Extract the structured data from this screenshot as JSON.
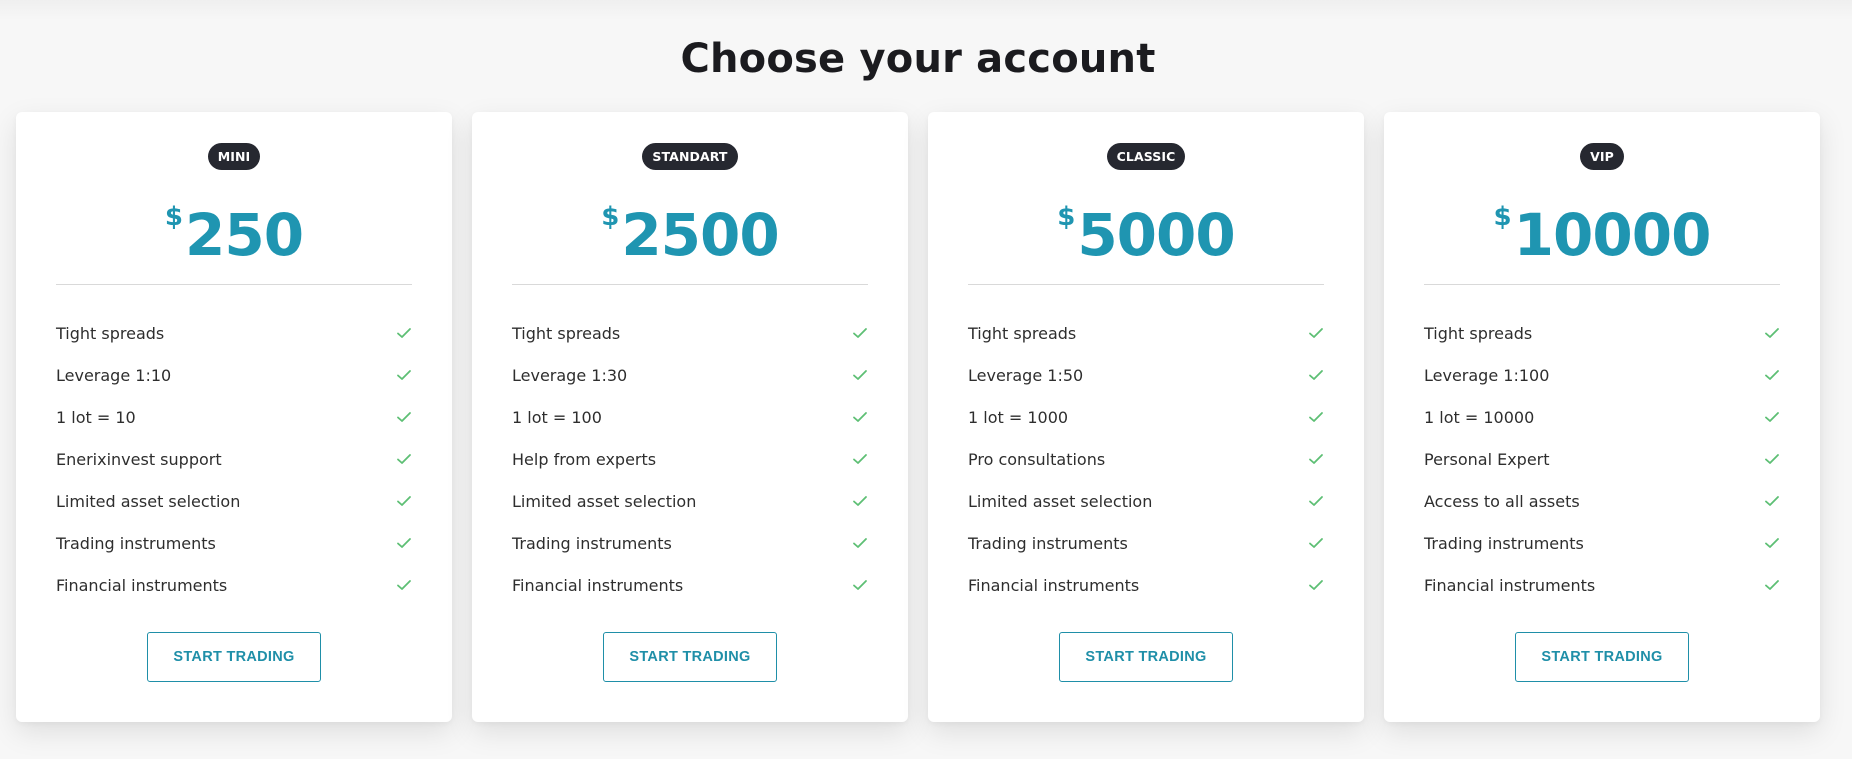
{
  "page": {
    "title": "Choose your account"
  },
  "colors": {
    "accent": "#1f95b1",
    "badge_bg": "#262830",
    "check": "#5dbf74",
    "button": "#1f8fa8"
  },
  "accounts": [
    {
      "badge": "MINI",
      "currency": "$",
      "amount": "250",
      "features": [
        {
          "label": "Tight spreads",
          "icon": "check-icon"
        },
        {
          "label": "Leverage 1:10",
          "icon": "check-icon"
        },
        {
          "label": "1 lot = 10",
          "icon": "check-icon"
        },
        {
          "label": "Enerixinvest support",
          "icon": "check-icon"
        },
        {
          "label": "Limited asset selection",
          "icon": "check-icon"
        },
        {
          "label": "Trading instruments",
          "icon": "check-icon"
        },
        {
          "label": "Financial instruments",
          "icon": "check-icon"
        }
      ],
      "button_label": "START TRADING"
    },
    {
      "badge": "STANDART",
      "currency": "$",
      "amount": "2500",
      "features": [
        {
          "label": "Tight spreads",
          "icon": "check-icon"
        },
        {
          "label": "Leverage 1:30",
          "icon": "check-icon"
        },
        {
          "label": "1 lot = 100",
          "icon": "check-icon"
        },
        {
          "label": "Help from experts",
          "icon": "check-icon"
        },
        {
          "label": "Limited asset selection",
          "icon": "check-icon"
        },
        {
          "label": "Trading instruments",
          "icon": "check-icon"
        },
        {
          "label": "Financial instruments",
          "icon": "check-icon"
        }
      ],
      "button_label": "START TRADING"
    },
    {
      "badge": "CLASSIC",
      "currency": "$",
      "amount": "5000",
      "features": [
        {
          "label": "Tight spreads",
          "icon": "check-icon"
        },
        {
          "label": "Leverage 1:50",
          "icon": "check-icon"
        },
        {
          "label": "1 lot = 1000",
          "icon": "check-icon"
        },
        {
          "label": "Pro consultations",
          "icon": "check-icon"
        },
        {
          "label": "Limited asset selection",
          "icon": "check-icon"
        },
        {
          "label": "Trading instruments",
          "icon": "check-icon"
        },
        {
          "label": "Financial instruments",
          "icon": "check-icon"
        }
      ],
      "button_label": "START TRADING"
    },
    {
      "badge": "VIP",
      "currency": "$",
      "amount": "10000",
      "features": [
        {
          "label": "Tight spreads",
          "icon": "check-icon"
        },
        {
          "label": "Leverage 1:100",
          "icon": "check-icon"
        },
        {
          "label": "1 lot = 10000",
          "icon": "check-icon"
        },
        {
          "label": "Personal Expert",
          "icon": "check-icon"
        },
        {
          "label": "Access to all assets",
          "icon": "check-icon"
        },
        {
          "label": "Trading instruments",
          "icon": "check-icon"
        },
        {
          "label": "Financial instruments",
          "icon": "check-icon"
        }
      ],
      "button_label": "START TRADING"
    }
  ]
}
